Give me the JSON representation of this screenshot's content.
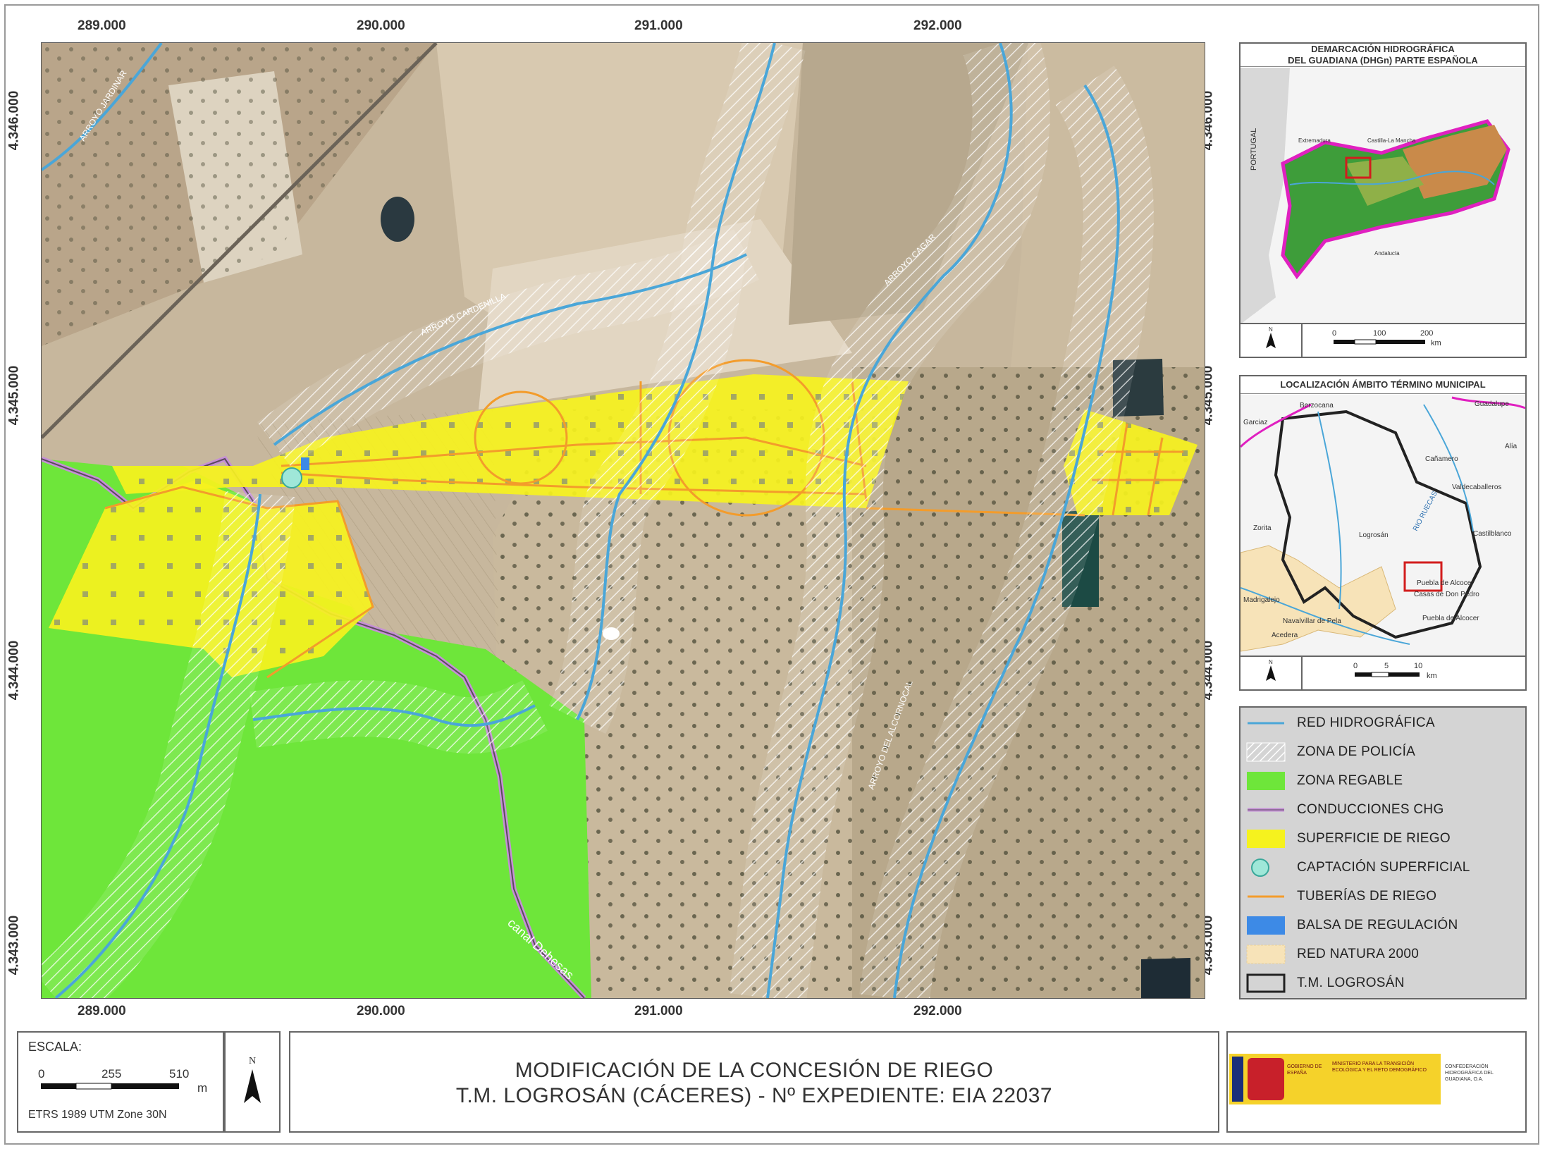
{
  "map": {
    "x_ticks_top": [
      "289.000",
      "290.000",
      "291.000",
      "292.000"
    ],
    "x_ticks_bottom": [
      "289.000",
      "290.000",
      "291.000",
      "292.000"
    ],
    "y_ticks_left": [
      "4.346.000",
      "4.345.000",
      "4.344.000",
      "4.343.000"
    ],
    "y_ticks_right": [
      "4.346.000",
      "4.345.000",
      "4.344.000",
      "4.343.000"
    ],
    "labels": {
      "arroyo_nw": "ARROYO JARDINAR",
      "arroyo_cardenilla": "ARROYO CARDENILLA",
      "arroyo_cagar": "ARROYO CAGAR",
      "arroyo_alcornocal": "ARROYO DEL ALCORNOCAL",
      "canal": "canal Dehesas"
    }
  },
  "inset_regional": {
    "title_line1": "DEMARCACIÓN HIDROGRÁFICA",
    "title_line2": "DEL GUADIANA (DHGn) PARTE ESPAÑOLA",
    "labels": [
      "PORTUGAL",
      "Extremadura",
      "Castilla-La Mancha",
      "Andalucía"
    ],
    "scale_ticks": [
      "0",
      "100",
      "200"
    ],
    "scale_unit": "km",
    "north": "N"
  },
  "inset_local": {
    "title": "LOCALIZACIÓN ÁMBITO TÉRMINO MUNICIPAL",
    "places": [
      "Berzocana",
      "Guadalupe",
      "Garciaz",
      "Cañamero",
      "Alía",
      "Valdecaballeros",
      "Zorita",
      "Logrosán",
      "Castilblanco",
      "Puebla de Alcocer",
      "Casas de Don Pedro",
      "Navalvillar de Pela",
      "Puebla de Alcocer",
      "Madrigalejo",
      "Acedera",
      "RIO RUECAS"
    ],
    "scale_ticks": [
      "0",
      "5",
      "10"
    ],
    "scale_unit": "km",
    "north": "N"
  },
  "legend": {
    "items": [
      {
        "label": "RED HIDROGRÁFICA",
        "color": "#4aa6d8"
      },
      {
        "label": "ZONA DE POLICÍA",
        "color": "#ffffff"
      },
      {
        "label": "ZONA REGABLE",
        "color": "#6ee63a"
      },
      {
        "label": "CONDUCCIONES CHG",
        "color": "#c58fd6"
      },
      {
        "label": "SUPERFICIE DE RIEGO",
        "color": "#f6f21e"
      },
      {
        "label": "CAPTACIÓN SUPERFICIAL",
        "color": "#9fe7d8"
      },
      {
        "label": "TUBERÍAS DE RIEGO",
        "color": "#f39c2b"
      },
      {
        "label": "BALSA DE REGULACIÓN",
        "color": "#3d8ae6"
      },
      {
        "label": "RED NATURA 2000",
        "color": "#f7e3b8"
      },
      {
        "label": "T.M. LOGROSÁN",
        "color": "#222222"
      }
    ]
  },
  "scale": {
    "title": "ESCALA:",
    "ticks": [
      "0",
      "255",
      "510"
    ],
    "unit": "m",
    "crs": "ETRS 1989 UTM Zone 30N",
    "north": "N"
  },
  "title": {
    "line1": "MODIFICACIÓN DE LA CONCESIÓN DE RIEGO",
    "line2": "T.M. LOGROSÁN (CÁCERES)  -  Nº EXPEDIENTE: EIA 22037"
  },
  "logos": {
    "gov": "GOBIERNO DE ESPAÑA",
    "ministry": "MINISTERIO PARA LA TRANSICIÓN ECOLÓGICA Y EL RETO DEMOGRÁFICO",
    "confed": "CONFEDERACIÓN HIDROGRÁFICA DEL GUADIANA, O.A."
  }
}
